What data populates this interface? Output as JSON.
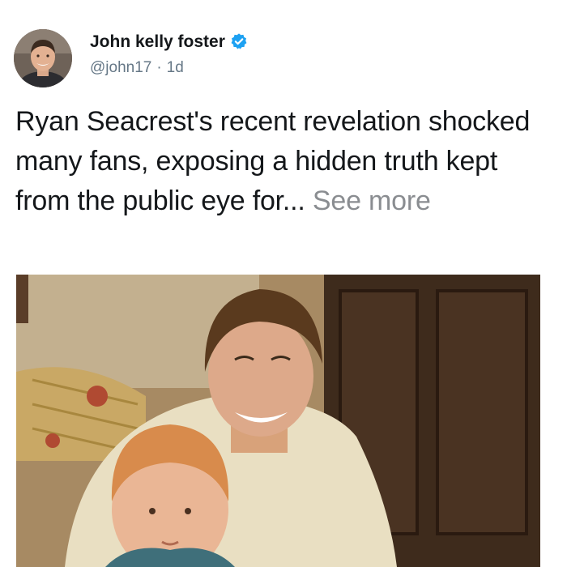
{
  "post": {
    "author": {
      "name": "John kelly foster",
      "handle": "@john17",
      "separator": "·",
      "time": "1d",
      "verified": true,
      "avatar_icon": "profile-photo"
    },
    "text": {
      "body": "Ryan Seacrest's recent revelation shocked many fans, exposing a hidden truth kept from the public eye for...",
      "see_more": "See more"
    },
    "media": {
      "type": "photo",
      "icon": "vintage-photo-father-and-child"
    },
    "colors": {
      "name": "#14171a",
      "meta": "#657786",
      "verified_badge": "#1da1f2",
      "see_more": "#8a8d91"
    }
  }
}
